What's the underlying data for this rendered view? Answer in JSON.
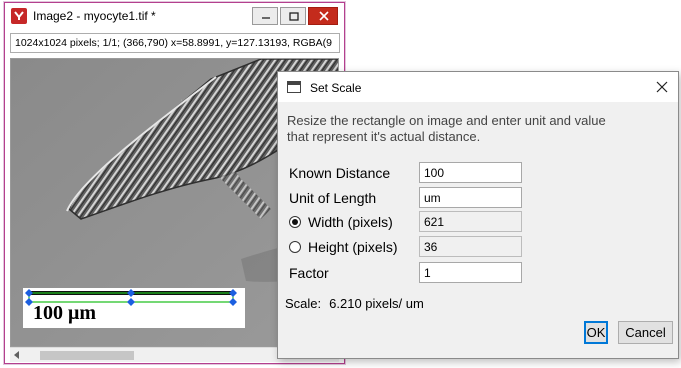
{
  "image_window": {
    "title": "Image2 - myocyte1.tif *",
    "info": "1024x1024 pixels; 1/1; (366,790) x=58.8991, y=127.13193, RGBA(9",
    "scale_bar_label": "100 μm",
    "app_icon": "imagej-app-icon",
    "controls": [
      "minimize-icon",
      "maximize-icon",
      "close-icon"
    ]
  },
  "dialog": {
    "title": "Set Scale",
    "instructions": [
      "Resize the rectangle on image and enter unit and value",
      "that represent it's actual distance."
    ],
    "fields": {
      "known_distance": {
        "label": "Known Distance",
        "value": "100"
      },
      "unit_of_length": {
        "label": "Unit of Length",
        "value": "um"
      },
      "width": {
        "label": "Width (pixels)",
        "value": "621",
        "selected": true
      },
      "height": {
        "label": "Height (pixels)",
        "value": "36",
        "selected": false
      },
      "factor": {
        "label": "Factor",
        "value": "1"
      }
    },
    "scale": {
      "label": "Scale:",
      "value": "6.210  pixels/ um"
    },
    "ok_label": "OK",
    "cancel_label": "Cancel"
  },
  "colors": {
    "window_border": "#b43f8e",
    "close_button": "#c42b1c",
    "selection_green": "#22c022",
    "handle_blue": "#1c5fe0",
    "ok_focus": "#0078d7"
  }
}
